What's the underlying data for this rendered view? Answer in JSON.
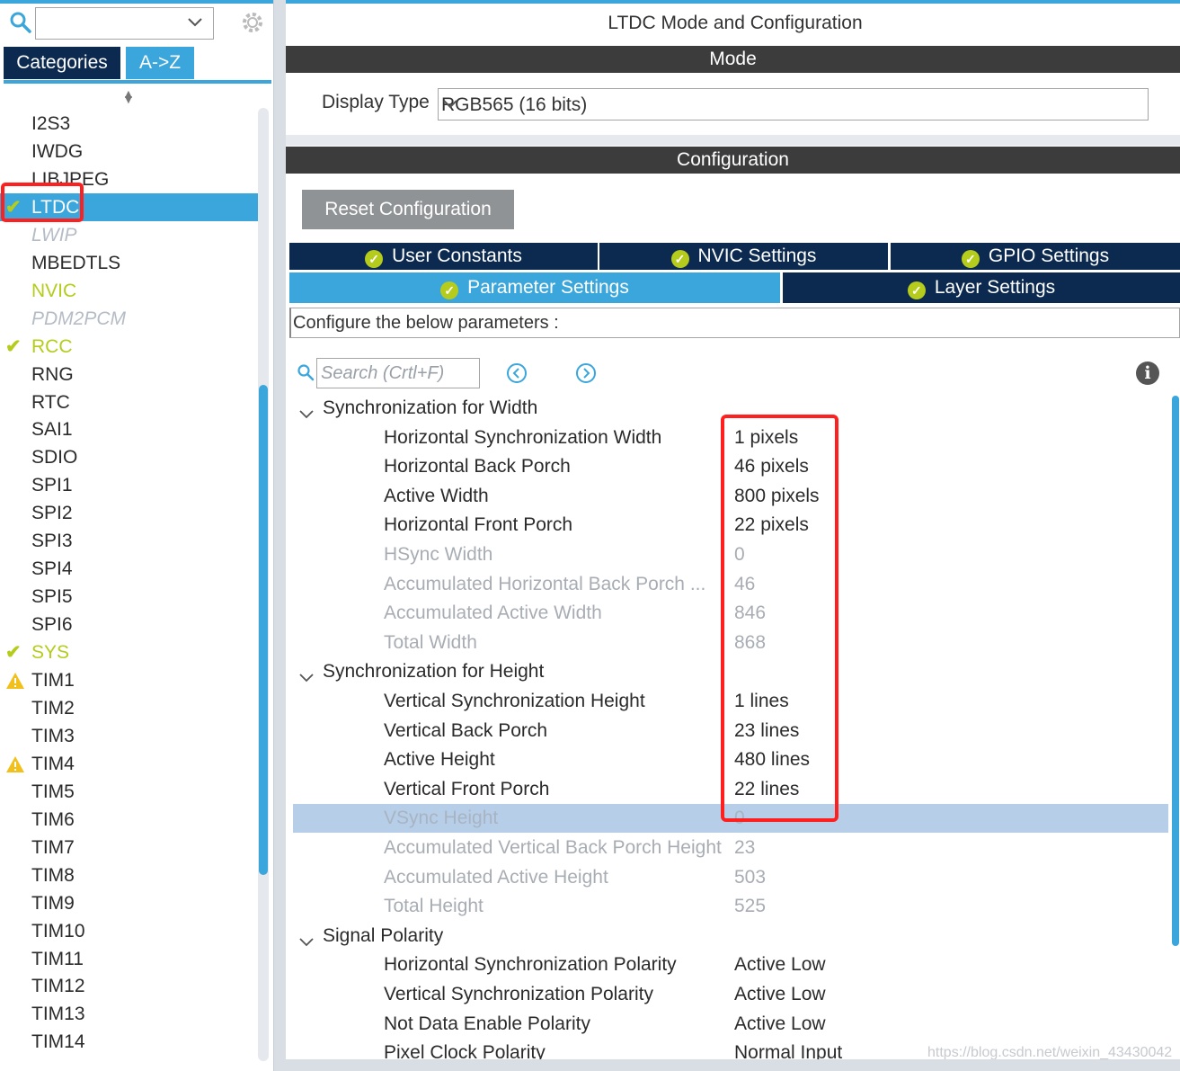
{
  "left_panel": {
    "search_value": "",
    "tabs": {
      "categories": "Categories",
      "az": "A->Z"
    },
    "items": [
      {
        "label": "I2S3",
        "state": "normal",
        "marker": ""
      },
      {
        "label": "IWDG",
        "state": "normal",
        "marker": ""
      },
      {
        "label": "LIBJPEG",
        "state": "normal",
        "marker": ""
      },
      {
        "label": "LTDC",
        "state": "selected",
        "marker": "check"
      },
      {
        "label": "LWIP",
        "state": "disabled",
        "marker": ""
      },
      {
        "label": "MBEDTLS",
        "state": "normal",
        "marker": ""
      },
      {
        "label": "NVIC",
        "state": "enabled",
        "marker": ""
      },
      {
        "label": "PDM2PCM",
        "state": "disabled",
        "marker": ""
      },
      {
        "label": "RCC",
        "state": "enabled",
        "marker": "check"
      },
      {
        "label": "RNG",
        "state": "normal",
        "marker": ""
      },
      {
        "label": "RTC",
        "state": "normal",
        "marker": ""
      },
      {
        "label": "SAI1",
        "state": "normal",
        "marker": ""
      },
      {
        "label": "SDIO",
        "state": "normal",
        "marker": ""
      },
      {
        "label": "SPI1",
        "state": "normal",
        "marker": ""
      },
      {
        "label": "SPI2",
        "state": "normal",
        "marker": ""
      },
      {
        "label": "SPI3",
        "state": "normal",
        "marker": ""
      },
      {
        "label": "SPI4",
        "state": "normal",
        "marker": ""
      },
      {
        "label": "SPI5",
        "state": "normal",
        "marker": ""
      },
      {
        "label": "SPI6",
        "state": "normal",
        "marker": ""
      },
      {
        "label": "SYS",
        "state": "enabled",
        "marker": "check"
      },
      {
        "label": "TIM1",
        "state": "warn",
        "marker": "warning"
      },
      {
        "label": "TIM2",
        "state": "normal",
        "marker": ""
      },
      {
        "label": "TIM3",
        "state": "normal",
        "marker": ""
      },
      {
        "label": "TIM4",
        "state": "warn",
        "marker": "warning"
      },
      {
        "label": "TIM5",
        "state": "normal",
        "marker": ""
      },
      {
        "label": "TIM6",
        "state": "normal",
        "marker": ""
      },
      {
        "label": "TIM7",
        "state": "normal",
        "marker": ""
      },
      {
        "label": "TIM8",
        "state": "normal",
        "marker": ""
      },
      {
        "label": "TIM9",
        "state": "normal",
        "marker": ""
      },
      {
        "label": "TIM10",
        "state": "normal",
        "marker": ""
      },
      {
        "label": "TIM11",
        "state": "normal",
        "marker": ""
      },
      {
        "label": "TIM12",
        "state": "normal",
        "marker": ""
      },
      {
        "label": "TIM13",
        "state": "normal",
        "marker": ""
      },
      {
        "label": "TIM14",
        "state": "normal",
        "marker": ""
      }
    ]
  },
  "right_panel": {
    "title": "LTDC Mode and Configuration",
    "mode_header": "Mode",
    "display_type_label": "Display Type",
    "display_type_value": "RGB565 (16 bits)",
    "config_header": "Configuration",
    "reset_button": "Reset Configuration",
    "tabs_row1": [
      "User Constants",
      "NVIC Settings",
      "GPIO Settings"
    ],
    "tabs_row2": [
      "Parameter Settings",
      "Layer Settings"
    ],
    "config_hint": "Configure the below parameters :",
    "search_placeholder": "Search (Crtl+F)",
    "groups": [
      {
        "title": "Synchronization for Width",
        "params": [
          {
            "name": "Horizontal Synchronization Width",
            "value": "1 pixels",
            "readonly": false
          },
          {
            "name": "Horizontal Back Porch",
            "value": "46 pixels",
            "readonly": false
          },
          {
            "name": "Active Width",
            "value": "800 pixels",
            "readonly": false
          },
          {
            "name": "Horizontal Front Porch",
            "value": "22 pixels",
            "readonly": false
          },
          {
            "name": "HSync Width",
            "value": "0",
            "readonly": true
          },
          {
            "name": "Accumulated Horizontal Back Porch ...",
            "value": "46",
            "readonly": true
          },
          {
            "name": "Accumulated Active Width",
            "value": "846",
            "readonly": true
          },
          {
            "name": "Total Width",
            "value": "868",
            "readonly": true
          }
        ]
      },
      {
        "title": "Synchronization for Height",
        "params": [
          {
            "name": "Vertical Synchronization Height",
            "value": "1 lines",
            "readonly": false
          },
          {
            "name": "Vertical Back Porch",
            "value": "23 lines",
            "readonly": false
          },
          {
            "name": "Active Height",
            "value": "480 lines",
            "readonly": false
          },
          {
            "name": "Vertical Front Porch",
            "value": "22 lines",
            "readonly": false
          },
          {
            "name": "VSync Height",
            "value": "0",
            "readonly": true,
            "highlighted": true
          },
          {
            "name": "Accumulated Vertical Back Porch Height",
            "value": "23",
            "readonly": true
          },
          {
            "name": "Accumulated Active Height",
            "value": "503",
            "readonly": true
          },
          {
            "name": "Total Height",
            "value": "525",
            "readonly": true
          }
        ]
      },
      {
        "title": "Signal Polarity",
        "params": [
          {
            "name": "Horizontal Synchronization Polarity",
            "value": "Active Low",
            "readonly": false
          },
          {
            "name": "Vertical Synchronization Polarity",
            "value": "Active Low",
            "readonly": false
          },
          {
            "name": "Not Data Enable Polarity",
            "value": "Active Low",
            "readonly": false
          },
          {
            "name": "Pixel Clock Polarity",
            "value": "Normal Input",
            "readonly": false
          }
        ]
      }
    ],
    "watermark": "https://blog.csdn.net/weixin_43430042"
  },
  "colors": {
    "accent_blue": "#3aa6dc",
    "navy": "#0c2a50",
    "enabled_green": "#b5cc1c",
    "warning_yellow": "#f2c01d",
    "annotation_red": "#ff1f1f",
    "header_gray": "#3c3c3c"
  }
}
